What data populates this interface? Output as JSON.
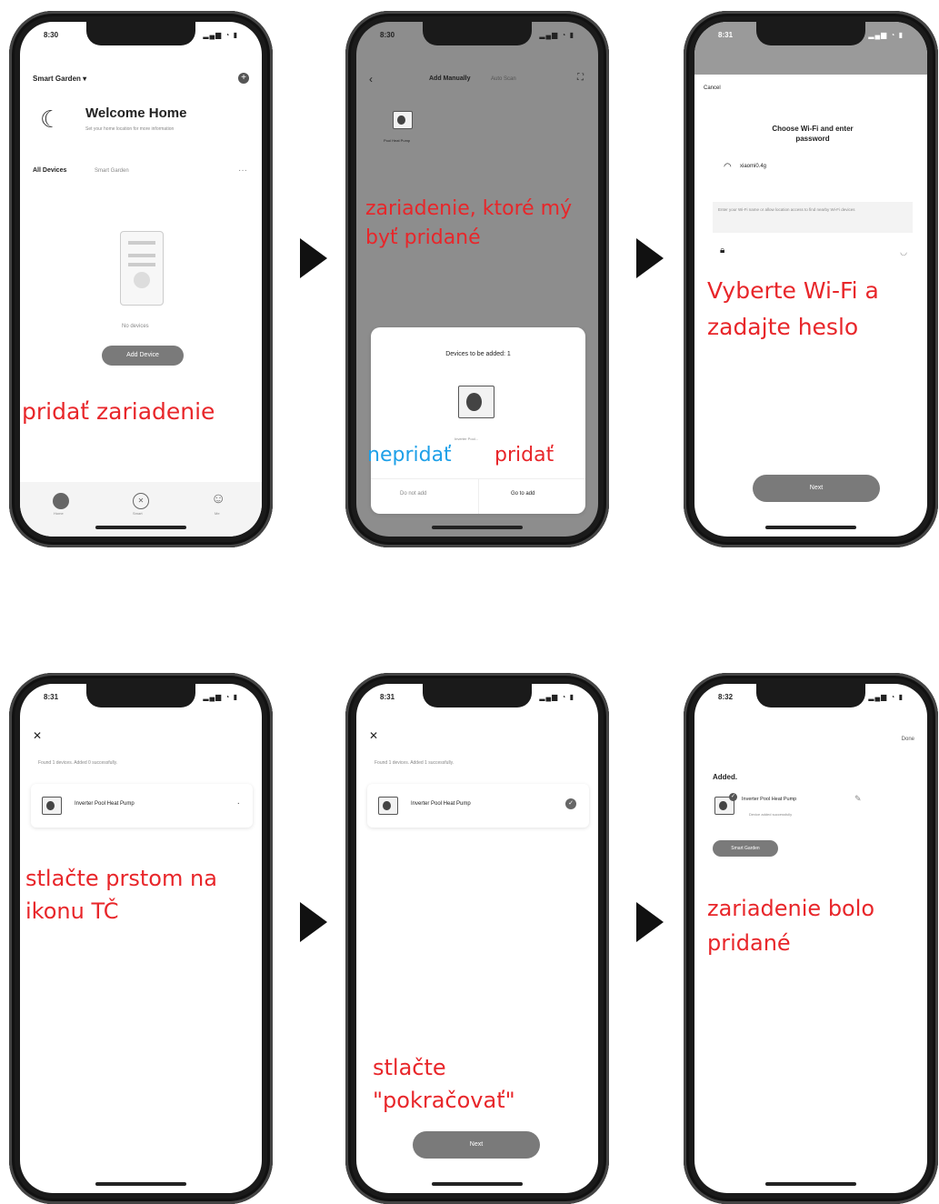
{
  "phones": {
    "p1": {
      "time": "8:30",
      "header_title": "Smart Garden",
      "welcome": "Welcome Home",
      "welcome_sub": "Set your home location for more information",
      "tab_all": "All Devices",
      "tab_room": "Smart Garden",
      "no_devices": "No devices",
      "add_button": "Add Device",
      "nav_home": "Home",
      "nav_smart": "Smart",
      "nav_me": "Me",
      "annotation": "pridať zariadenie"
    },
    "p2": {
      "time": "8:30",
      "tab_manual": "Add Manually",
      "tab_auto": "Auto Scan",
      "device_label": "Pool Heat Pump",
      "annotation": "zariadenie, ktoré mý byť pridané",
      "dialog_title": "Devices to be added: 1",
      "dialog_device": "Inverter Pool...",
      "btn_no": "Do not add",
      "btn_go": "Go to add",
      "annotation_no": "nepridať",
      "annotation_yes": "pridať"
    },
    "p3": {
      "time": "8:31",
      "cancel": "Cancel",
      "title": "Choose Wi-Fi and enter password",
      "wifi_name": "xiaomi0.4g",
      "hint": "Enter your Wi-Fi name or allow location access to find nearby Wi-Fi devices",
      "next": "Next",
      "annotation": "Vyberte Wi-Fi a zadajte heslo"
    },
    "p4": {
      "time": "8:31",
      "found": "Found 1 devices. Added 0 successfully.",
      "device": "Inverter Pool Heat Pump",
      "annotation": "stlačte prstom na ikonu TČ"
    },
    "p5": {
      "time": "8:31",
      "found": "Found 1 devices. Added 1 successfully.",
      "device": "Inverter Pool Heat Pump",
      "next": "Next",
      "annotation": "stlačte \"pokračovať\""
    },
    "p6": {
      "time": "8:32",
      "done": "Done",
      "added": "Added.",
      "device": "Inverter Pool Heat Pump",
      "success": "Device added successfully",
      "room": "Smart Garden",
      "annotation": "zariadenie bolo pridané"
    }
  }
}
